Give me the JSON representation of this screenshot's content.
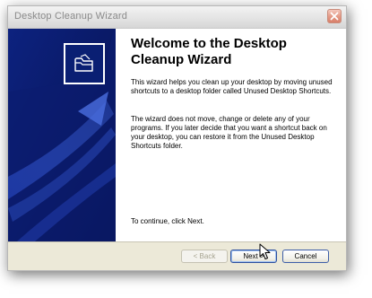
{
  "window": {
    "title": "Desktop Cleanup Wizard"
  },
  "content": {
    "heading": "Welcome to the Desktop Cleanup Wizard",
    "paragraph1": "This wizard helps you clean up your desktop by moving unused shortcuts to a desktop folder called Unused Desktop Shortcuts.",
    "paragraph2": "The wizard does not move, change or delete any of your programs. If you later decide that you want a shortcut back on your desktop, you can restore it from the Unused Desktop Shortcuts folder.",
    "continue_text": "To continue, click Next."
  },
  "buttons": {
    "back": "< Back",
    "next": "Next >",
    "cancel": "Cancel"
  },
  "icons": {
    "close": "close-icon",
    "wizard_logo": "folder-icon",
    "cursor": "mouse-cursor-icon"
  },
  "colors": {
    "side_panel": "#0a1a6a",
    "accent_border": "#2d4f9c",
    "close_button": "#d87f69"
  }
}
